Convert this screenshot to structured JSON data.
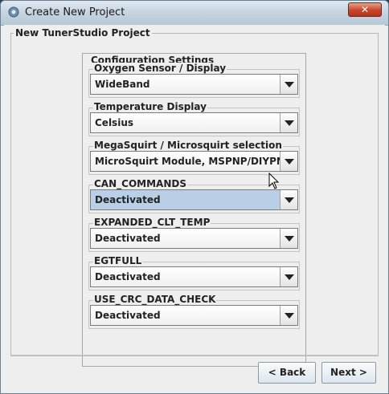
{
  "window": {
    "title": "Create New Project",
    "close_label": "✕"
  },
  "group": {
    "title": "New TunerStudio Project"
  },
  "config": {
    "title": "Configuration Settings",
    "fields": [
      {
        "label": "Oxygen Sensor / Display",
        "value": "WideBand"
      },
      {
        "label": "Temperature Display",
        "value": "Celsius"
      },
      {
        "label": "MegaSquirt / Microsquirt selection",
        "value": "MicroSquirt Module, MSPNP/DIYPNP"
      },
      {
        "label": "CAN_COMMANDS",
        "value": "Deactivated",
        "focused": true
      },
      {
        "label": "EXPANDED_CLT_TEMP",
        "value": "Deactivated"
      },
      {
        "label": "EGTFULL",
        "value": "Deactivated"
      },
      {
        "label": "USE_CRC_DATA_CHECK",
        "value": "Deactivated"
      }
    ]
  },
  "buttons": {
    "back": "< Back",
    "next": "Next >"
  },
  "colors": {
    "selected_combo": "#b8cfe5",
    "titlebar": "#c3d2de",
    "close": "#c8442c"
  }
}
